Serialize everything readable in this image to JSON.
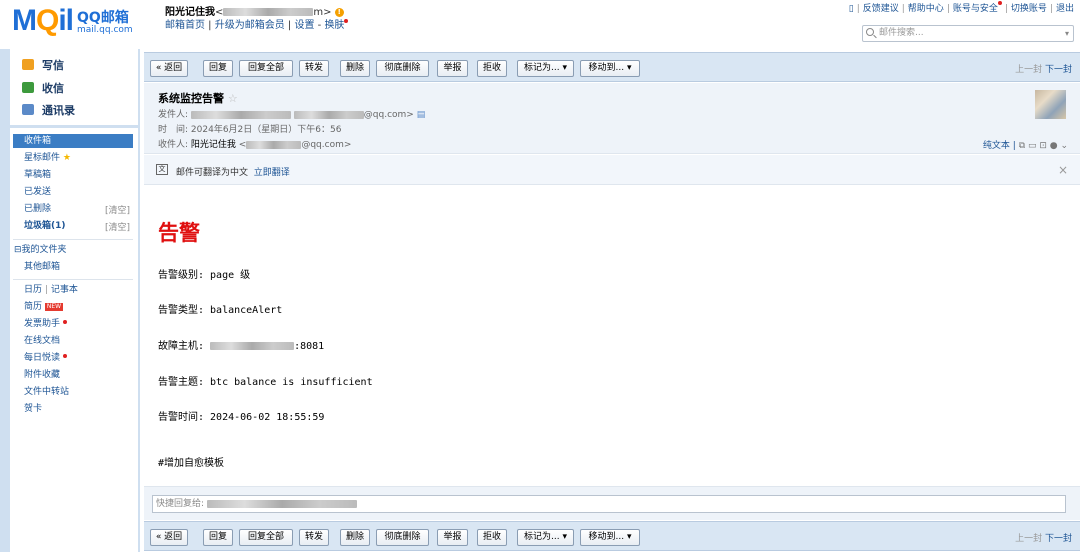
{
  "header": {
    "logo_mail": "MQil",
    "logo_qq": "QQ邮箱",
    "logo_domain": "mail.qq.com",
    "user_name": "阳光记住我",
    "user_email_suffix": "m>",
    "links": [
      "邮箱首页",
      "升级为邮箱会员",
      "设置",
      "换肤"
    ],
    "top_links": [
      "反馈建议",
      "帮助中心",
      "账号与安全",
      "切换账号",
      "退出"
    ],
    "search_placeholder": "邮件搜索..."
  },
  "quick": {
    "write": "写信",
    "receive": "收信",
    "contacts": "通讯录"
  },
  "sidebar": {
    "inbox": "收件箱",
    "starred": "星标邮件",
    "drafts": "草稿箱",
    "sent": "已发送",
    "deleted": "已删除",
    "deleted_clear": "[清空]",
    "spam": "垃圾箱(1)",
    "spam_clear": "[清空]",
    "my_folders": "⊟我的文件夹",
    "other": "其他邮箱",
    "calendar": "日历",
    "notes": "记事本",
    "resume": "简历",
    "resume_badge": "NEW",
    "invoice": "发票助手",
    "docs": "在线文档",
    "daily": "每日悦读",
    "attachments": "附件收藏",
    "transfer": "文件中转站",
    "cards": "贺卡"
  },
  "toolbar": {
    "back": "« 返回",
    "reply": "回复",
    "reply_all": "回复全部",
    "forward": "转发",
    "delete": "删除",
    "delete_perm": "彻底删除",
    "report": "举报",
    "reject": "拒收",
    "mark": "标记为...",
    "move": "移动到...",
    "prev": "上一封",
    "next": "下一封"
  },
  "message": {
    "subject": "系统监控告警",
    "from_label": "发件人:",
    "from_suffix": "@qq.com>",
    "time_label": "时　间:",
    "time": "2024年6月2日（星期日）下午6：56",
    "to_label": "收件人:",
    "to_name": "阳光记住我",
    "to_suffix": "@qq.com>",
    "plain": "纯文本 |",
    "translate_text": "邮件可翻译为中文",
    "translate_link": "立即翻译"
  },
  "body": {
    "heading": "告警",
    "level": "告警级别: page 级",
    "type": "告警类型: balanceAlert",
    "host_prefix": "故障主机:",
    "host_suffix": ":8081",
    "topic": "告警主题: btc balance is insufficient",
    "time": "告警时间: 2024-06-02 18:55:59",
    "template": "#增加自愈模板"
  },
  "reply": {
    "placeholder": "快捷回复给:"
  }
}
